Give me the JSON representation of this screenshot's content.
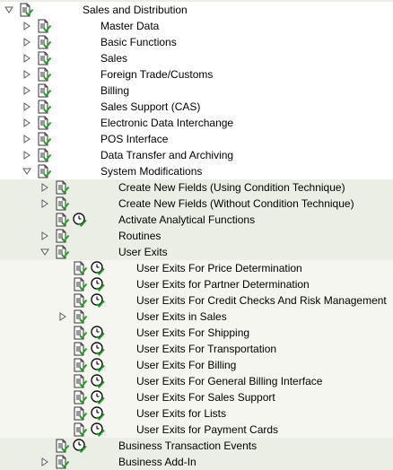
{
  "tree": [
    {
      "label": "Sales and Distribution",
      "level": 0,
      "expander": "expanded",
      "icon": "document-icon",
      "exec": false
    },
    {
      "label": "Master Data",
      "level": 1,
      "expander": "collapsed",
      "icon": "document-icon",
      "exec": false
    },
    {
      "label": "Basic Functions",
      "level": 1,
      "expander": "collapsed",
      "icon": "document-icon",
      "exec": false
    },
    {
      "label": "Sales",
      "level": 1,
      "expander": "collapsed",
      "icon": "document-icon",
      "exec": false
    },
    {
      "label": "Foreign Trade/Customs",
      "level": 1,
      "expander": "collapsed",
      "icon": "document-icon",
      "exec": false
    },
    {
      "label": "Billing",
      "level": 1,
      "expander": "collapsed",
      "icon": "document-icon",
      "exec": false
    },
    {
      "label": "Sales Support (CAS)",
      "level": 1,
      "expander": "collapsed",
      "icon": "document-icon",
      "exec": false
    },
    {
      "label": "Electronic Data Interchange",
      "level": 1,
      "expander": "collapsed",
      "icon": "document-icon",
      "exec": false
    },
    {
      "label": "POS Interface",
      "level": 1,
      "expander": "collapsed",
      "icon": "document-icon",
      "exec": false
    },
    {
      "label": "Data Transfer and Archiving",
      "level": 1,
      "expander": "collapsed",
      "icon": "document-icon",
      "exec": false
    },
    {
      "label": "System Modifications",
      "level": 1,
      "expander": "expanded",
      "icon": "document-icon",
      "exec": false
    },
    {
      "label": "Create New Fields (Using Condition Technique)",
      "level": 2,
      "expander": "collapsed",
      "icon": "document-icon",
      "exec": false
    },
    {
      "label": "Create New Fields (Without Condition Technique)",
      "level": 2,
      "expander": "collapsed",
      "icon": "document-icon",
      "exec": false
    },
    {
      "label": "Activate Analytical Functions",
      "level": 2,
      "expander": "none",
      "icon": "document-icon",
      "exec": true
    },
    {
      "label": "Routines",
      "level": 2,
      "expander": "collapsed",
      "icon": "document-icon",
      "exec": false
    },
    {
      "label": "User Exits",
      "level": 2,
      "expander": "expanded",
      "icon": "document-icon",
      "exec": false
    },
    {
      "label": "User Exits For Price Determination",
      "level": 3,
      "expander": "none",
      "icon": "document-icon",
      "exec": true
    },
    {
      "label": "User Exits for Partner Determination",
      "level": 3,
      "expander": "none",
      "icon": "document-icon",
      "exec": true
    },
    {
      "label": "User Exits For Credit Checks And Risk Management",
      "level": 3,
      "expander": "none",
      "icon": "document-icon",
      "exec": true
    },
    {
      "label": "User Exits in Sales",
      "level": 3,
      "expander": "collapsed",
      "icon": "document-icon",
      "exec": false
    },
    {
      "label": "User Exits For Shipping",
      "level": 3,
      "expander": "none",
      "icon": "document-icon",
      "exec": true
    },
    {
      "label": "User Exits For Transportation",
      "level": 3,
      "expander": "none",
      "icon": "document-icon",
      "exec": true
    },
    {
      "label": "User Exits For Billing",
      "level": 3,
      "expander": "none",
      "icon": "document-icon",
      "exec": true
    },
    {
      "label": "User Exits For General Billing Interface",
      "level": 3,
      "expander": "none",
      "icon": "document-icon",
      "exec": true
    },
    {
      "label": "User Exits For Sales Support",
      "level": 3,
      "expander": "none",
      "icon": "document-icon",
      "exec": true
    },
    {
      "label": "User Exits for Lists",
      "level": 3,
      "expander": "none",
      "icon": "document-icon",
      "exec": true
    },
    {
      "label": "User Exits for Payment Cards",
      "level": 3,
      "expander": "none",
      "icon": "document-icon",
      "exec": true
    },
    {
      "label": "Business Transaction Events",
      "level": 2,
      "expander": "none",
      "icon": "document-icon",
      "exec": true
    },
    {
      "label": "Business Add-In",
      "level": 2,
      "expander": "collapsed",
      "icon": "document-icon",
      "exec": false
    }
  ],
  "colors": {
    "background": "#eaeee4",
    "row_white": "#ffffff",
    "arrow_fill": "#ffffff",
    "arrow_stroke": "#5a5a5a",
    "doc_paper": "#ffffff",
    "doc_stroke": "#333333",
    "check_green": "#2f9a2f",
    "clock_face": "#ffffff"
  }
}
